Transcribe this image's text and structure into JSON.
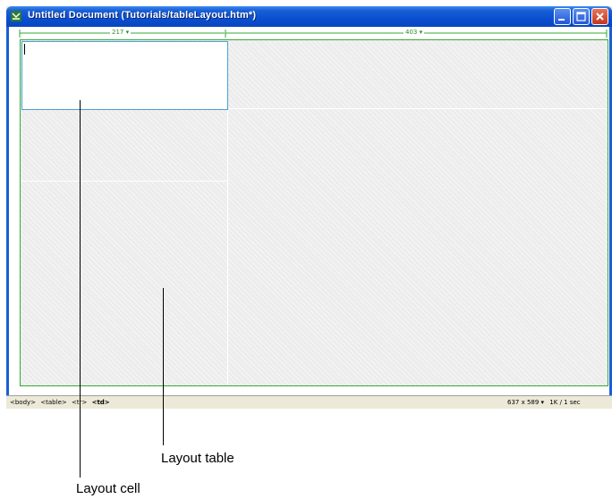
{
  "window": {
    "title": "Untitled Document (Tutorials/tableLayout.htm*)",
    "title_color": "#ffffff",
    "titlebar_color": "#0a4fd0"
  },
  "ruler": {
    "left_width": "217 ▾",
    "right_width": "403 ▾",
    "color": "#2a8a2a"
  },
  "statusbar": {
    "tags": [
      "<body>",
      "<table>",
      "<tr>",
      "<td>"
    ],
    "dimensions": "637 x 589 ▾",
    "download": "1K / 1 sec"
  },
  "callouts": {
    "layout_table": "Layout table",
    "layout_cell": "Layout cell"
  },
  "icons": {
    "app": "dreamweaver-document-icon",
    "minimize": "minimize-icon",
    "maximize": "maximize-icon",
    "close": "close-icon"
  }
}
